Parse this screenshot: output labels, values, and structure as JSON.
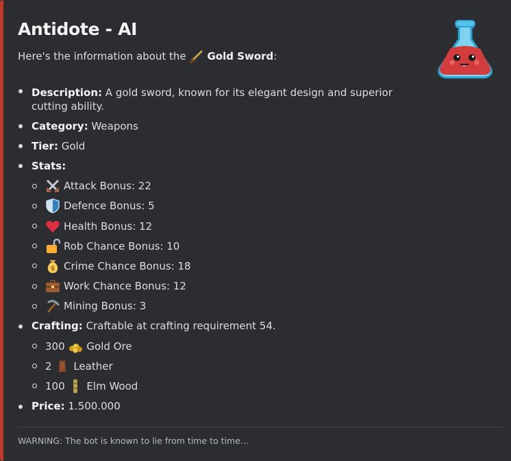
{
  "embed": {
    "accent_color": "#c0392b",
    "title": "Antidote - AI",
    "intro_prefix": "Here's the information about the",
    "item_name": "Gold Sword",
    "intro_suffix": ":",
    "thumbnail_icon": "potion-flask-icon",
    "fields": {
      "description_label": "Description:",
      "description_value": "A gold sword, known for its elegant design and superior cutting ability.",
      "category_label": "Category:",
      "category_value": "Weapons",
      "tier_label": "Tier:",
      "tier_value": "Gold",
      "stats_label": "Stats:",
      "stats": [
        {
          "icon": "crossed-swords-icon",
          "text": "Attack Bonus: 22"
        },
        {
          "icon": "shield-icon",
          "text": "Defence Bonus: 5"
        },
        {
          "icon": "heart-icon",
          "text": "Health Bonus: 12"
        },
        {
          "icon": "unlocked-padlock-icon",
          "text": "Rob Chance Bonus: 10"
        },
        {
          "icon": "money-bag-icon",
          "text": "Crime Chance Bonus: 18"
        },
        {
          "icon": "briefcase-icon",
          "text": "Work Chance Bonus: 12"
        },
        {
          "icon": "pickaxe-icon",
          "text": "Mining Bonus: 3"
        }
      ],
      "crafting_label": "Crafting:",
      "crafting_value": "Craftable at crafting requirement 54.",
      "materials": [
        {
          "qty": "300",
          "icon": "gold-ore-icon",
          "name": "Gold Ore"
        },
        {
          "qty": "2",
          "icon": "leather-icon",
          "name": "Leather"
        },
        {
          "qty": "100",
          "icon": "elm-wood-icon",
          "name": "Elm Wood"
        }
      ],
      "price_label": "Price:",
      "price_value": "1.500.000"
    },
    "footer": "WARNING: The bot is known to lie from time to time..."
  }
}
